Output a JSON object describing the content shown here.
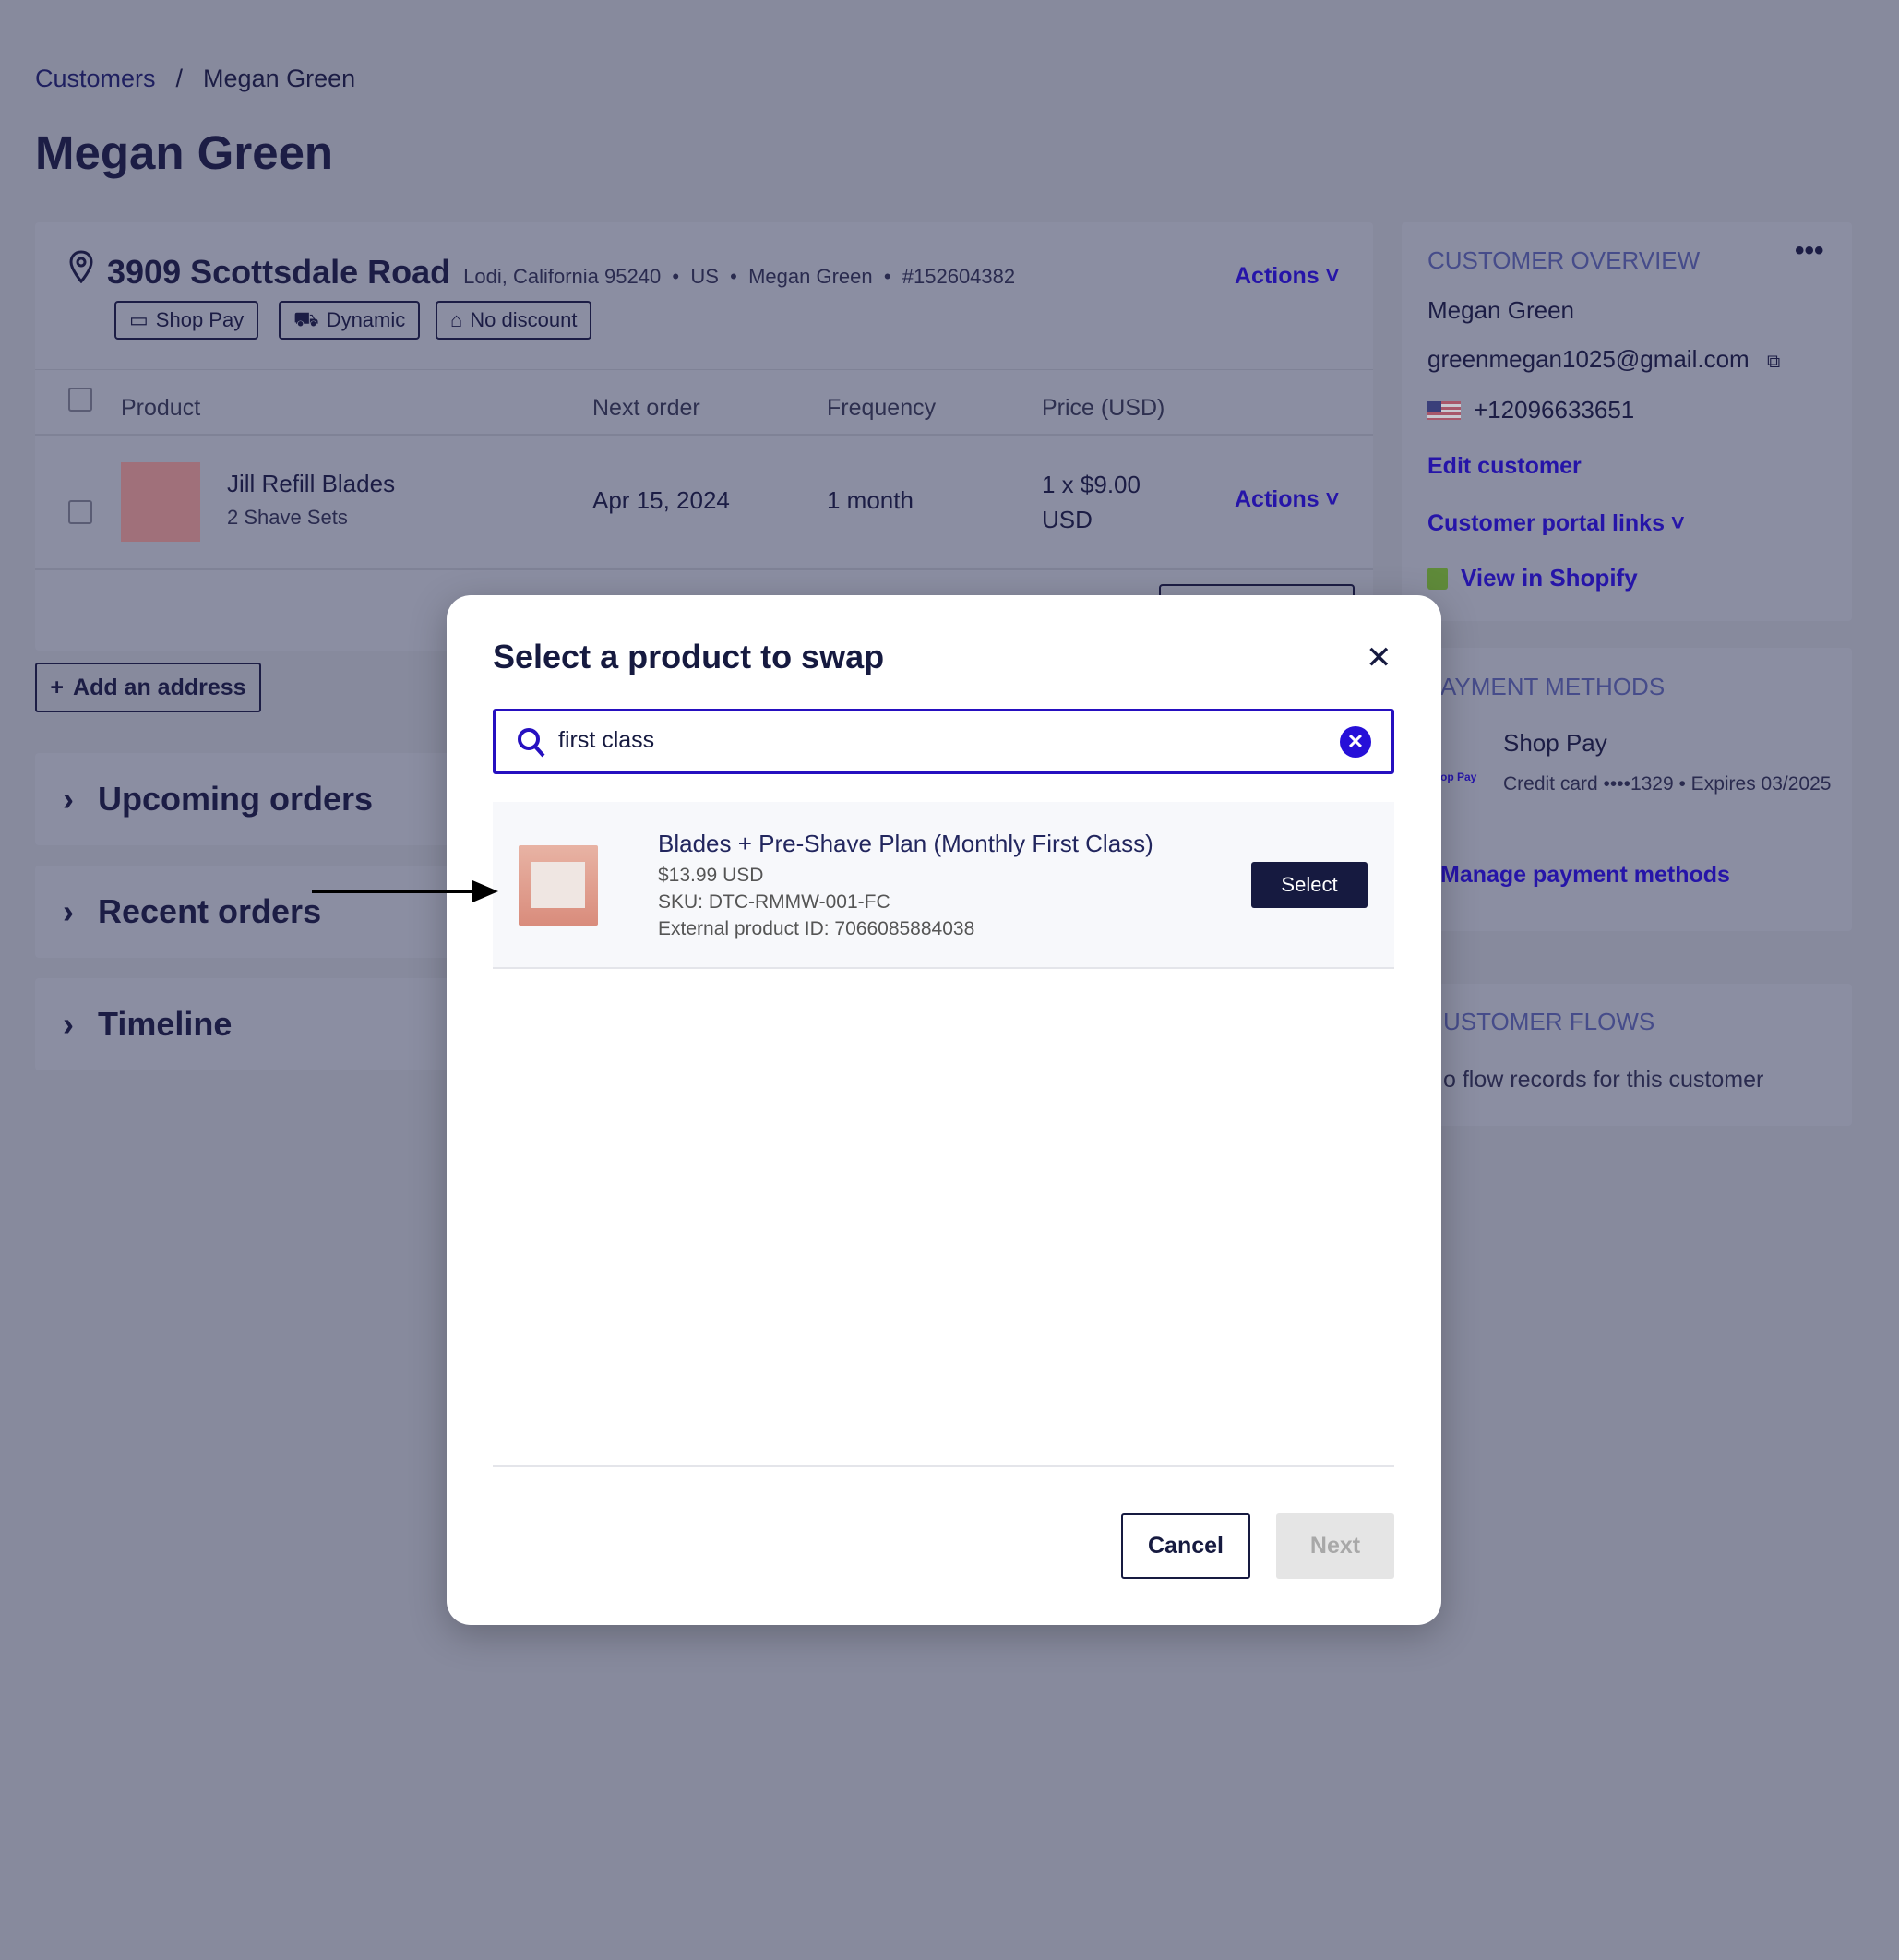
{
  "breadcrumb": {
    "parent": "Customers",
    "separator": "/",
    "current": "Megan Green"
  },
  "page_title": "Megan Green",
  "address": {
    "street": "3909 Scottsdale Road",
    "city": "Lodi, California 95240",
    "country": "US",
    "name": "Megan Green",
    "id": "#152604382",
    "actions": "Actions",
    "tags": [
      "Shop Pay",
      "Dynamic",
      "No discount"
    ]
  },
  "table": {
    "headers": [
      "Product",
      "Next order",
      "Frequency",
      "Price (USD)"
    ],
    "rows": [
      {
        "product": "Jill Refill Blades",
        "variant": "2 Shave Sets",
        "next_order": "Apr 15, 2024",
        "frequency": "1 month",
        "price_line1": "1 x $9.00",
        "price_line2": "USD",
        "actions": "Actions"
      }
    ]
  },
  "add_address": "Add an address",
  "panels": [
    "Upcoming orders",
    "Recent orders",
    "Timeline"
  ],
  "overview": {
    "heading": "CUSTOMER OVERVIEW",
    "name": "Megan Green",
    "email": "greenmegan1025@gmail.com",
    "phone": "+12096633651",
    "edit": "Edit customer",
    "portal": "Customer portal links",
    "shopify": "View in Shopify"
  },
  "payment": {
    "heading": "AYMENT METHODS",
    "method": "Shop Pay",
    "detail": "Credit card ••••1329 • Expires 03/2025",
    "manage": "Manage payment methods",
    "logo": "op Pay"
  },
  "flows": {
    "heading": "USTOMER FLOWS",
    "empty": "o flow records for this customer"
  },
  "modal": {
    "title": "Select a product to swap",
    "search_value": "first class",
    "result": {
      "title": "Blades + Pre-Shave Plan (Monthly First Class)",
      "price": "$13.99 USD",
      "sku": "SKU: DTC-RMMW-001-FC",
      "external_id": "External product ID: 7066085884038",
      "select": "Select"
    },
    "cancel": "Cancel",
    "next": "Next"
  },
  "colors": {
    "accent": "#2615a8",
    "primary_button": "#161a40",
    "overlay": "#878a9d"
  }
}
